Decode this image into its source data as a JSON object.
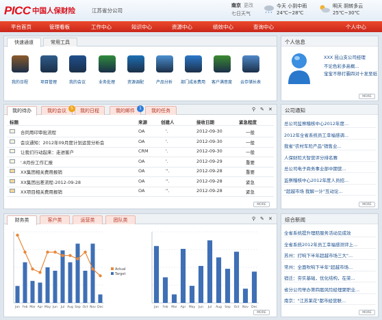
{
  "header": {
    "logo": "PICC",
    "brand": "中国人保财险",
    "branch": "江苏省分公司",
    "city": "南京",
    "city_change": "更改",
    "week": "七日天气",
    "weather": [
      {
        "day": "今天",
        "desc": "小到中雨",
        "temp": "24℃~28℃",
        "icon": "rain-cloud-icon"
      },
      {
        "day": "明天",
        "desc": "阴转多云",
        "temp": "25℃~30℃",
        "icon": "cloud-sun-icon"
      }
    ]
  },
  "nav": {
    "items": [
      "平台首页",
      "管理看板",
      "工作中心",
      "知识中心",
      "资源中心",
      "绩效中心",
      "查询中心",
      "个人中心"
    ]
  },
  "quick": {
    "tabs": [
      "快速通道",
      "常用工具"
    ],
    "items": [
      {
        "label": "我的日程",
        "icon": "briefcase-icon",
        "color": "#8a5a2b"
      },
      {
        "label": "项目管理",
        "icon": "folder-icon",
        "color": "#2e5c8a"
      },
      {
        "label": "我的会议",
        "icon": "meeting-icon",
        "color": "#1f4f8c"
      },
      {
        "label": "业务处理",
        "icon": "running-icon",
        "color": "#2f8a3c"
      },
      {
        "label": "资源调配",
        "icon": "magnifier-icon",
        "color": "#1d6fb3"
      },
      {
        "label": "产品分析",
        "icon": "chart-icon",
        "color": "#4b8fd0"
      },
      {
        "label": "部门成本费用",
        "icon": "yen-icon",
        "color": "#2b78c9"
      },
      {
        "label": "客户满意度",
        "icon": "phone-icon",
        "color": "#3c8a2f"
      },
      {
        "label": "云存储长表",
        "icon": "cloud-icon",
        "color": "#4e88c8"
      }
    ]
  },
  "profile": {
    "title": "个人信息",
    "lines": [
      "XXX 昆山支公司经理",
      "不论色彩多高概...",
      "宝宝不移打霸四对十发至纸"
    ],
    "more": "MORE"
  },
  "tasks": {
    "tabs": [
      {
        "label": "我的待办"
      },
      {
        "label": "我的会议",
        "badge": "5"
      },
      {
        "label": "我的日程"
      },
      {
        "label": "我的邮件",
        "badge": "1"
      },
      {
        "label": "我的任务"
      }
    ],
    "columns": [
      "标题",
      "来源",
      "创建人",
      "接收日期",
      "紧急程度"
    ],
    "rows": [
      {
        "title": "合同用印审批流程",
        "source": "OA",
        "creator": "'.",
        "date": "2012-09-30",
        "level": "一般",
        "icon": "mail-icon"
      },
      {
        "title": "会议通知：2012年09月度计划运营分析会",
        "source": "OA",
        "creator": "'.",
        "date": "2012-09-30",
        "level": "一般",
        "icon": "mail-icon"
      },
      {
        "title": "让我们行动起来：走进客户",
        "source": "CRM",
        "creator": "'.",
        "date": "2012-09-30",
        "level": "一般",
        "icon": "mail-icon"
      },
      {
        "title": "'.8月份工作汇报",
        "source": "OA",
        "creator": "'.",
        "date": "2012-09-29",
        "level": "重要",
        "icon": "mail-icon"
      },
      {
        "title": "XX集团相关费用报销",
        "source": "OA",
        "creator": "''.",
        "date": "2012-09-28",
        "level": "重要",
        "icon": "folder-icon"
      },
      {
        "title": "XX集团出差流程-2012-09-28",
        "source": "OA",
        "creator": "''.",
        "date": "2012-09-28",
        "level": "紧急",
        "icon": "folder-icon"
      },
      {
        "title": "XX项目相关费用报销",
        "source": "OA",
        "creator": "''.",
        "date": "2012-09-28",
        "level": "紧急",
        "icon": "folder-icon"
      }
    ],
    "more": "MORE"
  },
  "notice": {
    "title": "公司通知",
    "items": [
      "总公司监察稽核中心2012年度...",
      "2012年全省系统员工幸福感调...",
      "我省\"农村车险产品\"销售业...",
      "人保财险大智营评分排名赛",
      "总公司电子商务事业部中期营...",
      "监察稽核中心2012年度人员招...",
      "\"超越市场 我解一计\"互动论..."
    ],
    "more": "MORE"
  },
  "charts_panel": {
    "tabs": [
      "财务类",
      "客户类",
      "运营类",
      "团队类"
    ],
    "more": "MORE"
  },
  "news": {
    "title": "综合新闻",
    "items": [
      "全省系统提升理赔服务活动见成效",
      "全省系统2012年员工幸福感测评上...",
      "苏州：打响下半年超越市场三大\"...",
      "常州：全面吹响下半年\"超越市场...",
      "宿迁：夯实基础，优化结构，在荣...",
      "省分公司举办第四届风险经理聚职业...",
      "南京：\"江苏莱花\"都市经营联..."
    ],
    "more": "MORE"
  },
  "chart_data": [
    {
      "type": "bar",
      "categories": [
        "Jan",
        "Feb",
        "Mar",
        "Apr",
        "May",
        "Jun",
        "Jul",
        "Aug",
        "Sep",
        "Oct",
        "Nov",
        "Dec"
      ],
      "series": [
        {
          "name": "Actual",
          "type": "line",
          "color": "#e8883a",
          "values": [
            40,
            30,
            20,
            18,
            30,
            30,
            28,
            28,
            26,
            30,
            20,
            16
          ]
        },
        {
          "name": "Target",
          "type": "bar",
          "color": "#3f6fb5",
          "values": [
            10,
            24,
            13,
            12,
            21,
            19,
            31,
            24,
            35,
            19,
            35,
            5
          ]
        }
      ],
      "ylim": [
        0,
        42
      ]
    },
    {
      "type": "bar",
      "categories": [
        "Jan",
        "Feb",
        "Mar",
        "Apr",
        "May",
        "Jun",
        "Jul",
        "Aug",
        "Sep",
        "Oct",
        "Nov",
        "Dec"
      ],
      "series": [
        {
          "color": "#3f6fb5",
          "values": [
            20,
            9,
            3,
            19,
            6,
            13,
            22,
            16,
            12,
            18,
            5,
            11
          ]
        }
      ],
      "ylim": [
        0,
        25
      ]
    }
  ]
}
